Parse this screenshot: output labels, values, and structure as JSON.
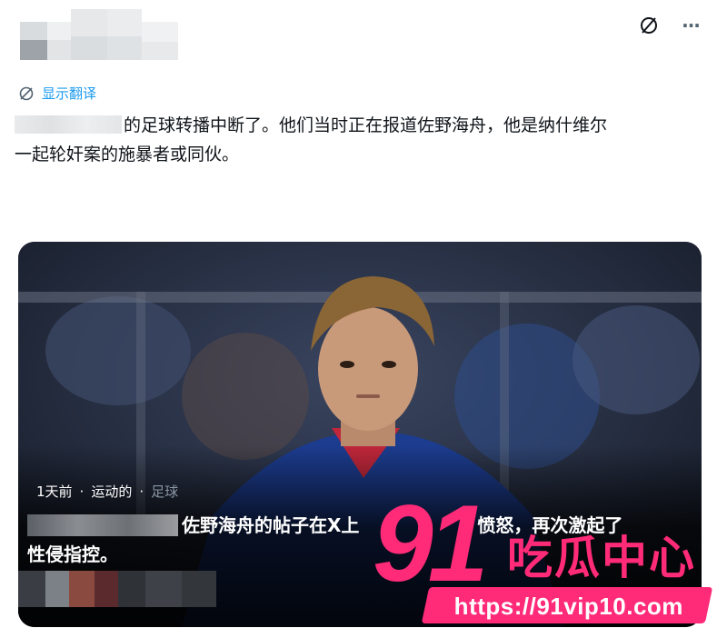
{
  "post": {
    "translate_label": "显示翻译",
    "body_line1_after_redact": "的足球转播中断了。他们当时正在报道佐野海舟，他是纳什维尔",
    "body_line2": "一起轮奸案的施暴者或同伙。"
  },
  "top_actions": {
    "translate_icon": "translate-icon",
    "more_label": "···"
  },
  "card": {
    "meta_time": "1天前",
    "meta_category": "运动的",
    "meta_sub": "足球",
    "title_line1_after_redact": "佐野海舟的帖子在X上",
    "title_line1_tail": "愤怒，再次激起了",
    "title_line2": "性侵指控。"
  },
  "watermark": {
    "number": "91",
    "brand": "吃瓜中心",
    "url": "https://91vip10.com"
  },
  "colors": {
    "link_blue": "#1d9bf0",
    "watermark_pink": "#ff2a78"
  }
}
